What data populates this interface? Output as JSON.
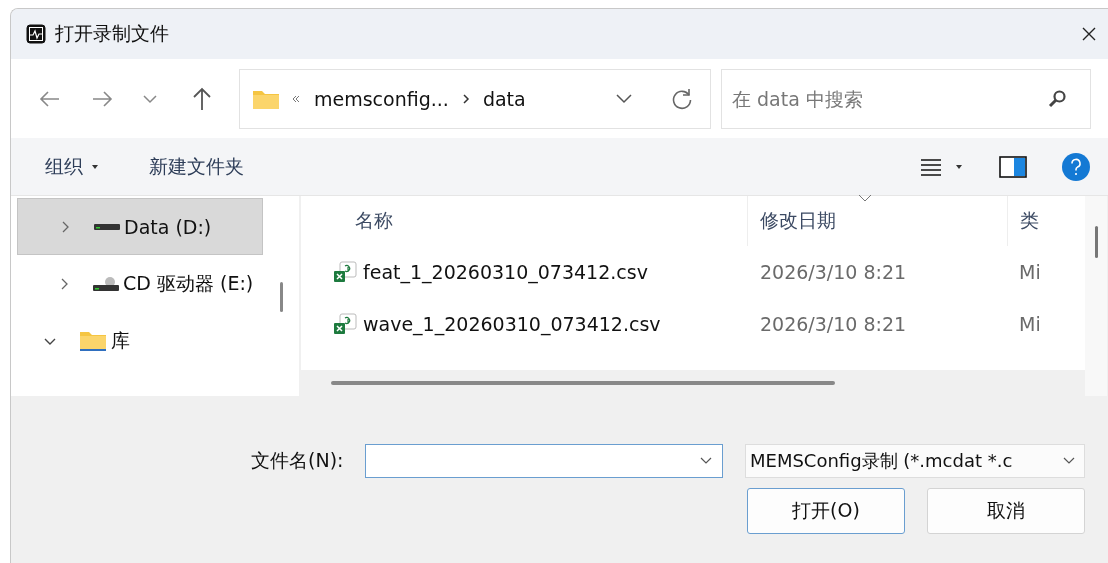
{
  "window": {
    "title": "打开录制文件"
  },
  "nav": {
    "path": [
      {
        "label": "memsconfig..."
      },
      {
        "label": "data"
      }
    ],
    "search": {
      "placeholder": "在 data 中搜索"
    }
  },
  "commands": {
    "organize": "组织",
    "new_folder": "新建文件夹"
  },
  "sidebar": {
    "items": [
      {
        "label": "Data (D:)",
        "kind": "drive",
        "selected": true,
        "expanded": false
      },
      {
        "label": "CD 驱动器 (E:)",
        "kind": "cd",
        "selected": false,
        "expanded": false
      },
      {
        "label": "库",
        "kind": "folder",
        "selected": false,
        "expanded": true
      }
    ]
  },
  "table": {
    "columns": [
      "名称",
      "修改日期",
      "类"
    ],
    "rows": [
      {
        "name": "feat_1_20260310_073412.csv",
        "date": "2026/3/10 8:21",
        "column_3": "Mi"
      },
      {
        "name": "wave_1_20260310_073412.csv",
        "date": "2026/3/10 8:21",
        "column_3": "Mi"
      }
    ]
  },
  "footer": {
    "filename_label": "文件名(N):",
    "filter": "MEMSConfig录制 (*.mcdat *.c",
    "buttons": [
      "打开(O)",
      "取消"
    ]
  }
}
